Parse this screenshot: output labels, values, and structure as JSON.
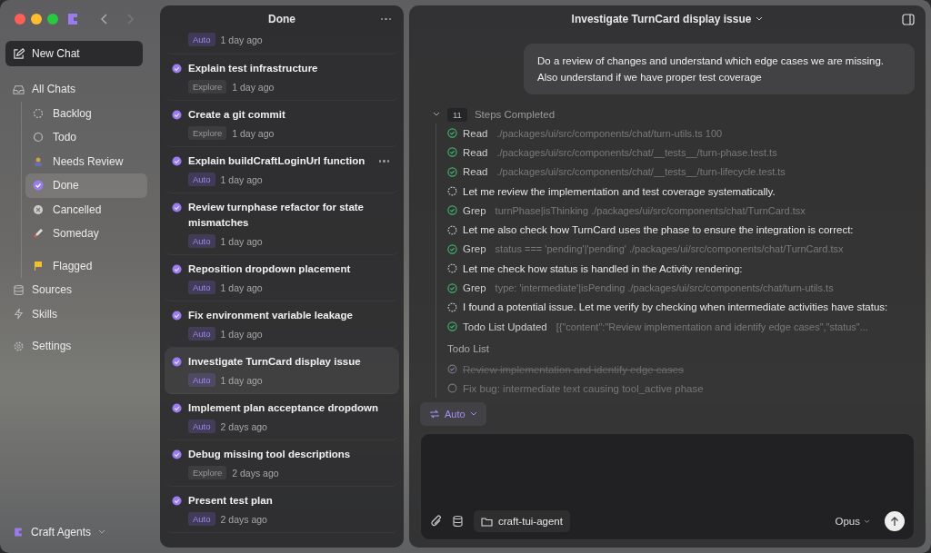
{
  "sidebar": {
    "new_chat": "New Chat",
    "nav": [
      {
        "label": "All Chats",
        "kind": "inbox",
        "selected": false,
        "children": [
          {
            "label": "Backlog",
            "kind": "backlog",
            "selected": false
          },
          {
            "label": "Todo",
            "kind": "todo",
            "selected": false
          },
          {
            "label": "Needs Review",
            "kind": "review",
            "selected": false
          },
          {
            "label": "Done",
            "kind": "done",
            "selected": true
          },
          {
            "label": "Cancelled",
            "kind": "cancelled",
            "selected": false
          },
          {
            "label": "Someday",
            "kind": "someday",
            "selected": false
          },
          {
            "label": "Flagged",
            "kind": "flag",
            "selected": false
          }
        ]
      },
      {
        "label": "Sources",
        "kind": "sources",
        "selected": false
      },
      {
        "label": "Skills",
        "kind": "skills",
        "selected": false
      },
      {
        "label": "Settings",
        "kind": "settings",
        "selected": false
      }
    ],
    "workspace": "Craft Agents"
  },
  "list": {
    "title": "Done",
    "items": [
      {
        "mode": "Auto",
        "kind": "auto",
        "time": "1 day ago",
        "selected": false
      },
      {
        "title": "Explain test infrastructure",
        "mode": "Explore",
        "kind": "explore",
        "time": "1 day ago",
        "selected": false
      },
      {
        "title": "Create a git commit",
        "mode": "Explore",
        "kind": "explore",
        "time": "1 day ago",
        "selected": false
      },
      {
        "title": "Explain buildCraftLoginUrl function",
        "mode": "Auto",
        "kind": "auto",
        "time": "1 day ago",
        "selected": false,
        "hovered": true
      },
      {
        "title": "Review turnphase refactor for state mismatches",
        "mode": "Auto",
        "kind": "auto",
        "time": "1 day ago",
        "selected": false
      },
      {
        "title": "Reposition dropdown placement",
        "mode": "Auto",
        "kind": "auto",
        "time": "1 day ago",
        "selected": false
      },
      {
        "title": "Fix environment variable leakage",
        "mode": "Auto",
        "kind": "auto",
        "time": "1 day ago",
        "selected": false
      },
      {
        "title": "Investigate TurnCard display issue",
        "mode": "Auto",
        "kind": "auto",
        "time": "1 day ago",
        "selected": true
      },
      {
        "title": "Implement plan acceptance dropdown",
        "mode": "Auto",
        "kind": "auto",
        "time": "2 days ago",
        "selected": false
      },
      {
        "title": "Debug missing tool descriptions",
        "mode": "Explore",
        "kind": "explore",
        "time": "2 days ago",
        "selected": false
      },
      {
        "title": "Present test plan",
        "mode": "Auto",
        "kind": "auto",
        "time": "2 days ago",
        "selected": false
      }
    ]
  },
  "chat": {
    "title": "Investigate TurnCard display issue",
    "user_message": "Do a review of changes and understand which edge cases we are missing. Also understand if we have proper test coverage",
    "steps_count": "11",
    "steps_label": "Steps Completed",
    "steps_expanded": true,
    "steps": [
      {
        "kind": "tool",
        "name": "Read",
        "detail": "./packages/ui/src/components/chat/turn-utils.ts 100"
      },
      {
        "kind": "tool",
        "name": "Read",
        "detail": "./packages/ui/src/components/chat/__tests__/turn-phase.test.ts"
      },
      {
        "kind": "tool",
        "name": "Read",
        "detail": "./packages/ui/src/components/chat/__tests__/turn-lifecycle.test.ts"
      },
      {
        "kind": "thought",
        "text": "Let me review the implementation and test coverage systematically."
      },
      {
        "kind": "tool",
        "name": "Grep",
        "detail": "turnPhase|isThinking ./packages/ui/src/components/chat/TurnCard.tsx"
      },
      {
        "kind": "thought",
        "text": "Let me also check how TurnCard uses the phase to ensure the integration is correct:"
      },
      {
        "kind": "tool",
        "name": "Grep",
        "detail": "status === 'pending'|'pending' ./packages/ui/src/components/chat/TurnCard.tsx"
      },
      {
        "kind": "thought",
        "text": "Let me check how status is handled in the Activity rendering:"
      },
      {
        "kind": "tool",
        "name": "Grep",
        "detail": "type: 'intermediate'|isPending ./packages/ui/src/components/chat/turn-utils.ts"
      },
      {
        "kind": "thought",
        "text": "I found a potential issue. Let me verify by checking when intermediate activities have status:"
      },
      {
        "kind": "tool",
        "name": "Todo List Updated",
        "detail": "[{\"content\":\"Review implementation and identify edge cases\",\"status\"..."
      }
    ],
    "todo_title": "Todo List",
    "todos": [
      {
        "text": "Review implementation and identify edge cases",
        "done": true
      },
      {
        "text": "Fix bug: intermediate text causing tool_active phase",
        "done": false
      }
    ],
    "mode": "Auto",
    "folder": "craft-tui-agent",
    "model": "Opus"
  }
}
